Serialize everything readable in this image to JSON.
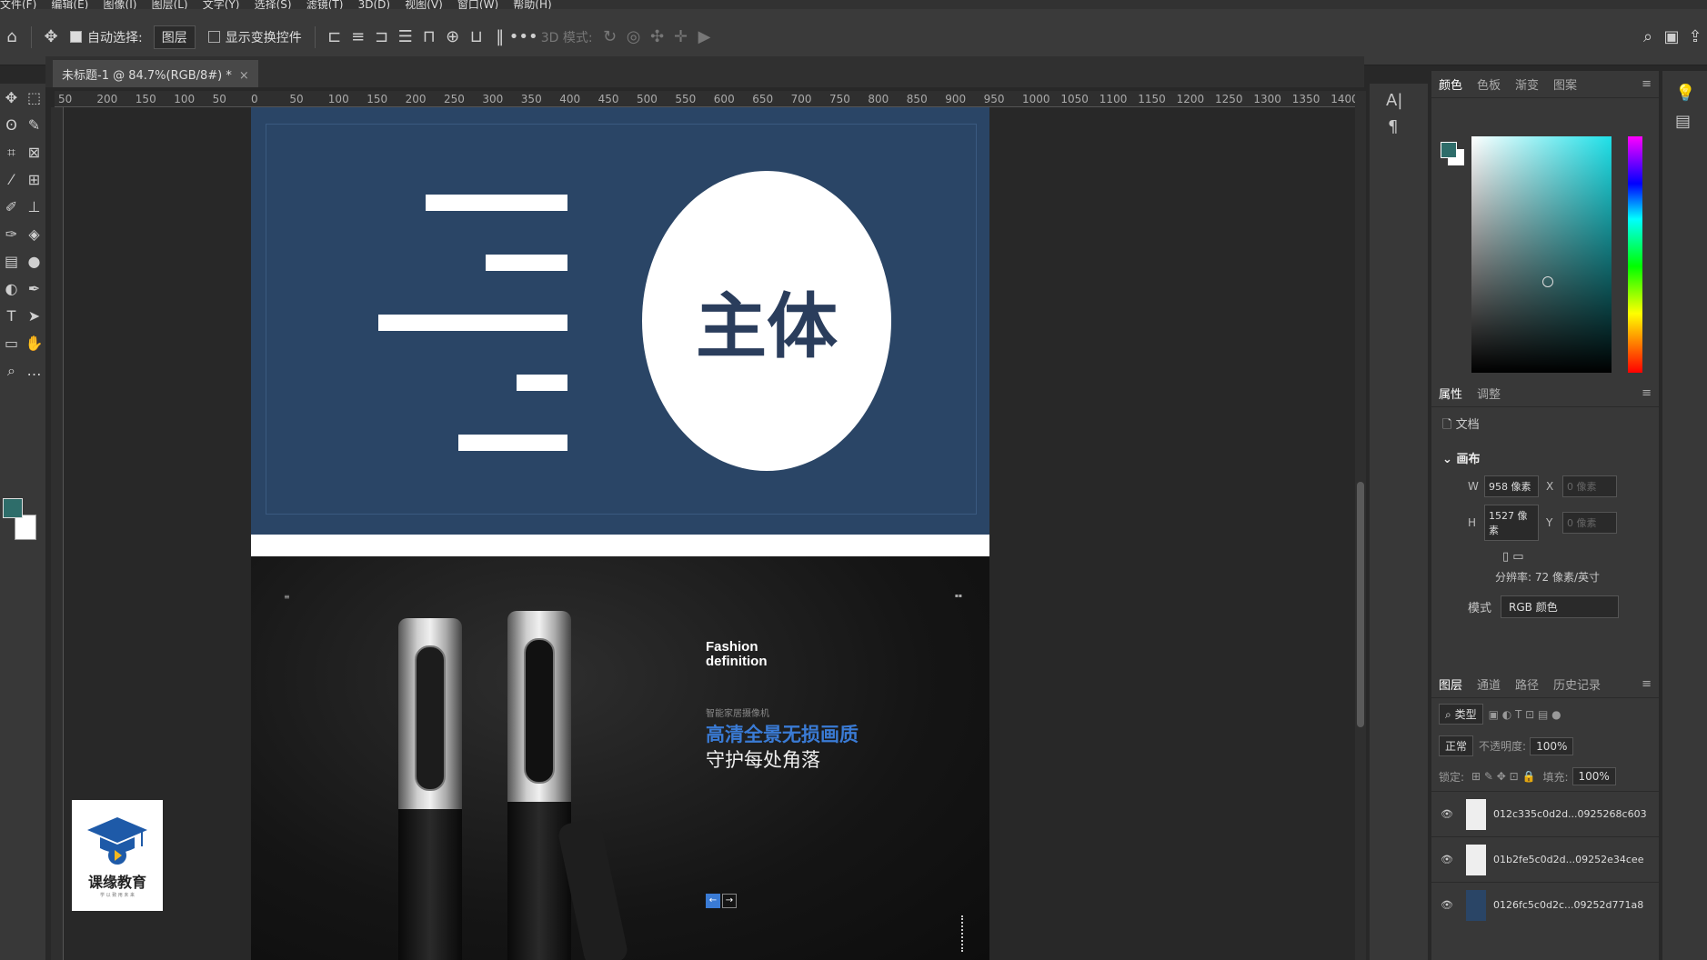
{
  "menubar": {
    "items": [
      "文件(F)",
      "编辑(E)",
      "图像(I)",
      "图层(L)",
      "文字(Y)",
      "选择(S)",
      "滤镜(T)",
      "3D(D)",
      "视图(V)",
      "窗口(W)",
      "帮助(H)"
    ]
  },
  "options": {
    "auto_select_label": "自动选择:",
    "layer_select": "图层",
    "show_transform_label": "显示变换控件",
    "mode_3d_label": "3D 模式:"
  },
  "document": {
    "tab_title": "未标题-1 @ 84.7%(RGB/8#) *",
    "ruler_ticks": [
      "50",
      "200",
      "150",
      "100",
      "50",
      "0",
      "50",
      "100",
      "150",
      "200",
      "250",
      "300",
      "350",
      "400",
      "450",
      "500",
      "550",
      "600",
      "650",
      "700",
      "750",
      "800",
      "850",
      "900",
      "950",
      "1000",
      "1050",
      "1100",
      "1150",
      "1200",
      "1250",
      "1300",
      "1350",
      "1400"
    ]
  },
  "canvas": {
    "circle_text": "主体",
    "fashion_line1": "Fashion",
    "fashion_line2": "definition",
    "small_cn": "智能家居摄像机",
    "blue_cn": "高清全景无损画质",
    "white_cn": "守护每处角落",
    "logo_text": "课缘教育",
    "logo_sub": "学 以 致 用 未 来"
  },
  "color_panel": {
    "tabs": [
      "颜色",
      "色板",
      "渐变",
      "图案"
    ],
    "active_tab": "颜色",
    "fg_color": "#2e6d6a"
  },
  "properties": {
    "tabs": [
      "属性",
      "调整"
    ],
    "doc_label": "文档",
    "section": "画布",
    "w_label": "W",
    "w_value": "958 像素",
    "h_label": "H",
    "h_value": "1527 像素",
    "x_label": "X",
    "x_value": "0 像素",
    "y_label": "Y",
    "y_value": "0 像素",
    "resolution": "分辨率: 72 像素/英寸",
    "mode_label": "模式",
    "mode_value": "RGB 颜色"
  },
  "layers_panel": {
    "tabs": [
      "图层",
      "通道",
      "路径",
      "历史记录"
    ],
    "filter": "类型",
    "blend": "正常",
    "opacity_label": "不透明度:",
    "opacity": "100%",
    "lock_label": "锁定:",
    "fill_label": "填充:",
    "fill": "100%",
    "items": [
      "012c335c0d2d...0925268c603",
      "01b2fe5c0d2d...09252e34cee",
      "0126fc5c0d2c...09252d771a8"
    ]
  }
}
